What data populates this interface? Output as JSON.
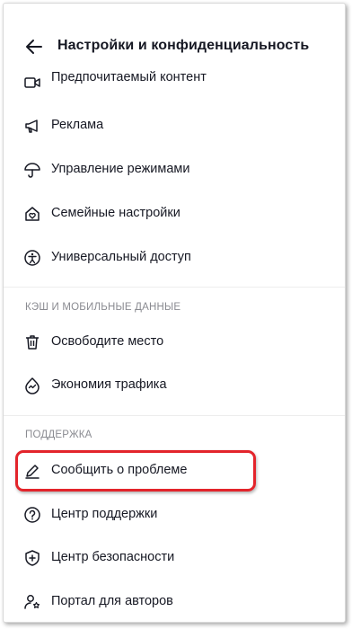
{
  "header": {
    "title": "Настройки и конфиденциальность"
  },
  "items": {
    "preferred_content": "Предпочитаемый контент",
    "ads": "Реклама",
    "modes": "Управление режимами",
    "family": "Семейные настройки",
    "accessibility": "Универсальный доступ",
    "free_space": "Освободите место",
    "data_saver": "Экономия трафика",
    "report_problem": "Сообщить о проблеме",
    "help_center": "Центр поддержки",
    "safety_center": "Центр безопасности",
    "creator_portal": "Портал для авторов"
  },
  "sections": {
    "cache": "КЭШ И МОБИЛЬНЫЕ ДАННЫЕ",
    "support": "ПОДДЕРЖКА"
  },
  "colors": {
    "highlight": "#e3242b",
    "text": "#161823",
    "section_text": "#8a8b91"
  }
}
